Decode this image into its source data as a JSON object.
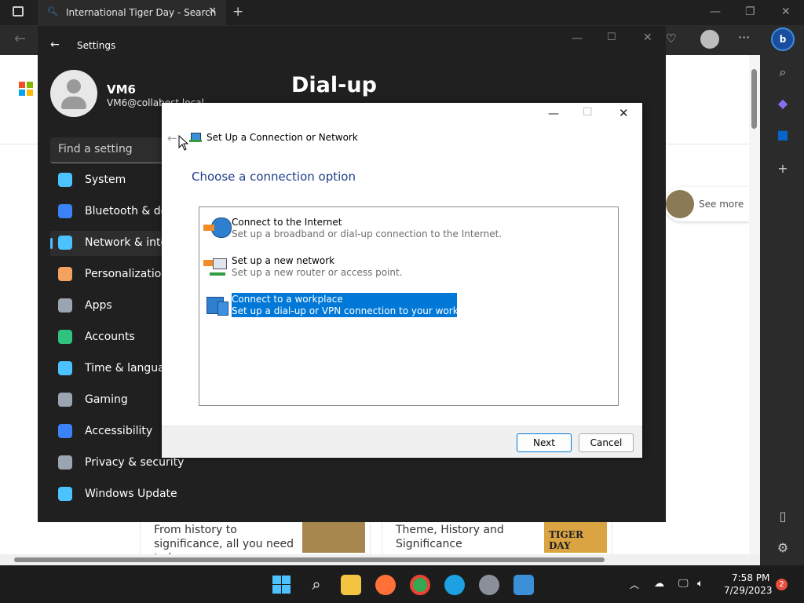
{
  "browser": {
    "tab_title": "International Tiger Day - Search",
    "newtab_glyph": "+",
    "close_glyph": "✕",
    "more_glyph": "···"
  },
  "webpage": {
    "see_more": "See more",
    "card1_text": "From history to significance, all you need to know",
    "card2_text": "Theme, History and Significance",
    "tiger_logo_text": "TIGER DAY"
  },
  "settings": {
    "window_title": "Settings",
    "page_title": "Dial-up",
    "user_name": "VM6",
    "user_email": "VM6@collabest.local",
    "find_placeholder": "Find a setting",
    "nav": [
      {
        "label": "System",
        "color": "#4cc2ff"
      },
      {
        "label": "Bluetooth & dev",
        "color": "#3b82f6"
      },
      {
        "label": "Network & inter",
        "color": "#4cc2ff"
      },
      {
        "label": "Personalization",
        "color": "#f4a261"
      },
      {
        "label": "Apps",
        "color": "#9aa5b1"
      },
      {
        "label": "Accounts",
        "color": "#2ec27e"
      },
      {
        "label": "Time & languag",
        "color": "#4cc2ff"
      },
      {
        "label": "Gaming",
        "color": "#9aa5b1"
      },
      {
        "label": "Accessibility",
        "color": "#3b82f6"
      },
      {
        "label": "Privacy & security",
        "color": "#9aa5b1"
      },
      {
        "label": "Windows Update",
        "color": "#4cc2ff"
      }
    ]
  },
  "dialog": {
    "title": "Set Up a Connection or Network",
    "heading": "Choose a connection option",
    "options": [
      {
        "title": "Connect to the Internet",
        "desc": "Set up a broadband or dial-up connection to the Internet."
      },
      {
        "title": "Set up a new network",
        "desc": "Set up a new router or access point."
      },
      {
        "title": "Connect to a workplace",
        "desc": "Set up a dial-up or VPN connection to your workplace.",
        "selected": true
      }
    ],
    "next_label": "Next",
    "cancel_label": "Cancel"
  },
  "taskbar": {
    "time": "7:58 PM",
    "date": "7/29/2023",
    "notification_count": "2"
  },
  "colors": {
    "accent": "#0078d7",
    "selection": "#0078d7",
    "dialog_heading": "#1e3e8a"
  }
}
